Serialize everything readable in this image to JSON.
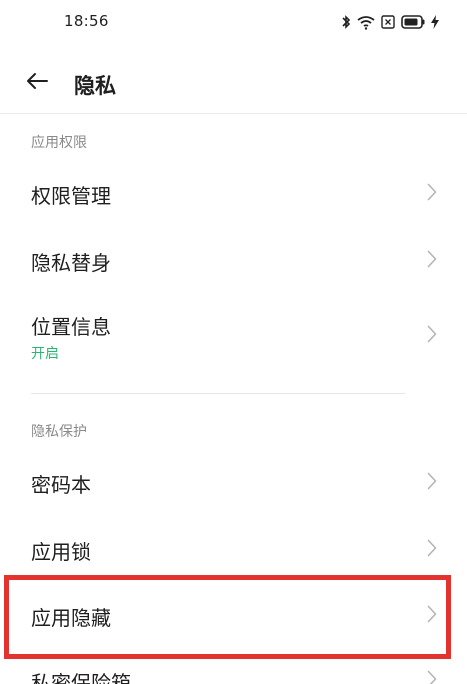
{
  "status_bar": {
    "time": "18:56"
  },
  "header": {
    "title": "隐私"
  },
  "sections": [
    {
      "header": "应用权限",
      "items": [
        {
          "label": "权限管理"
        },
        {
          "label": "隐私替身"
        },
        {
          "label": "位置信息",
          "sublabel": "开启"
        }
      ]
    },
    {
      "header": "隐私保护",
      "items": [
        {
          "label": "密码本"
        },
        {
          "label": "应用锁"
        },
        {
          "label": "应用隐藏"
        },
        {
          "label": "私密保险箱"
        }
      ]
    }
  ],
  "colors": {
    "accent_green": "#2bb673",
    "highlight_red": "#e2332f"
  },
  "icons": [
    "bluetooth-icon",
    "wifi-icon",
    "sim-icon",
    "battery-icon",
    "charging-icon",
    "back-arrow-icon",
    "chevron-right-icon"
  ]
}
